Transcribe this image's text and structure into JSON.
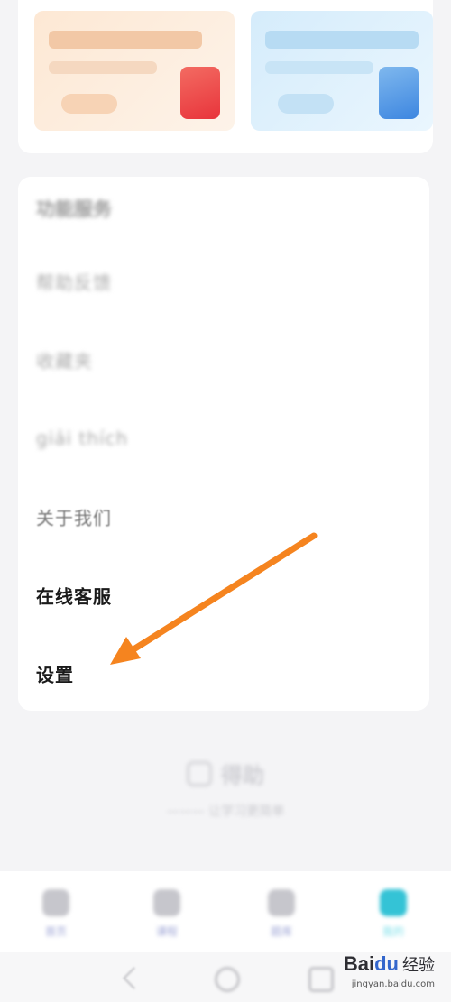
{
  "menu": {
    "heading": "功能服务",
    "items": [
      {
        "label": "帮助反馈",
        "style": "blurred"
      },
      {
        "label": "收藏夹",
        "style": "blurred"
      },
      {
        "label": "giải thích",
        "style": "blurred"
      },
      {
        "label": "关于我们",
        "style": "soft"
      },
      {
        "label": "在线客服",
        "style": "sharp"
      },
      {
        "label": "设置",
        "style": "sharp"
      }
    ]
  },
  "brand": {
    "name": "得助",
    "slogan": "让学习更简单"
  },
  "tabbar": {
    "tabs": [
      {
        "label": "首页",
        "active": false
      },
      {
        "label": "课程",
        "active": false
      },
      {
        "label": "题库",
        "active": false
      },
      {
        "label": "我的",
        "active": true
      }
    ]
  },
  "annotation": {
    "color": "#f5841f"
  },
  "watermark": {
    "logo_a": "Bai",
    "logo_b": "du",
    "text": "经验",
    "sub": "jingyan.baidu.com"
  }
}
